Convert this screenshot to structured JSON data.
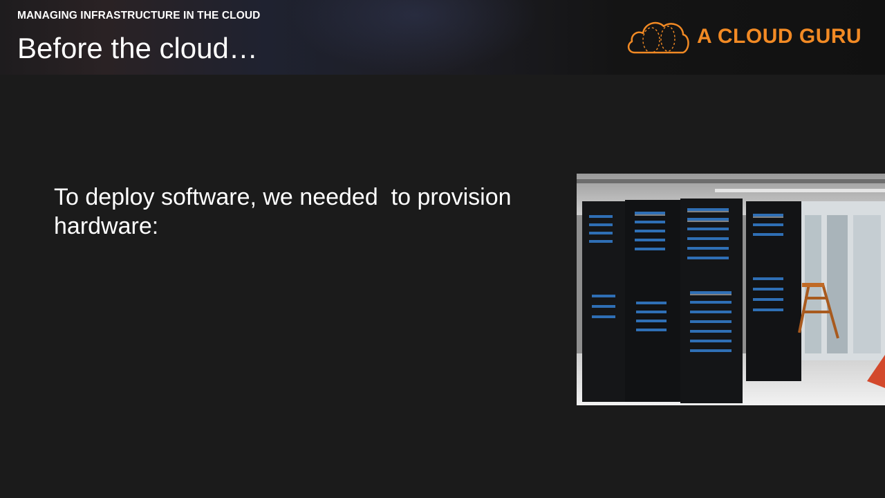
{
  "header": {
    "course_title": "MANAGING INFRASTRUCTURE IN THE CLOUD",
    "slide_title": "Before the cloud…",
    "logo_text": "A CLOUD GURU",
    "logo_icon": "cloud-logo-icon",
    "brand_color": "#f28a24"
  },
  "content": {
    "body_text": "To deploy software, we needed  to provision hardware:",
    "image": "server-racks-photo"
  }
}
